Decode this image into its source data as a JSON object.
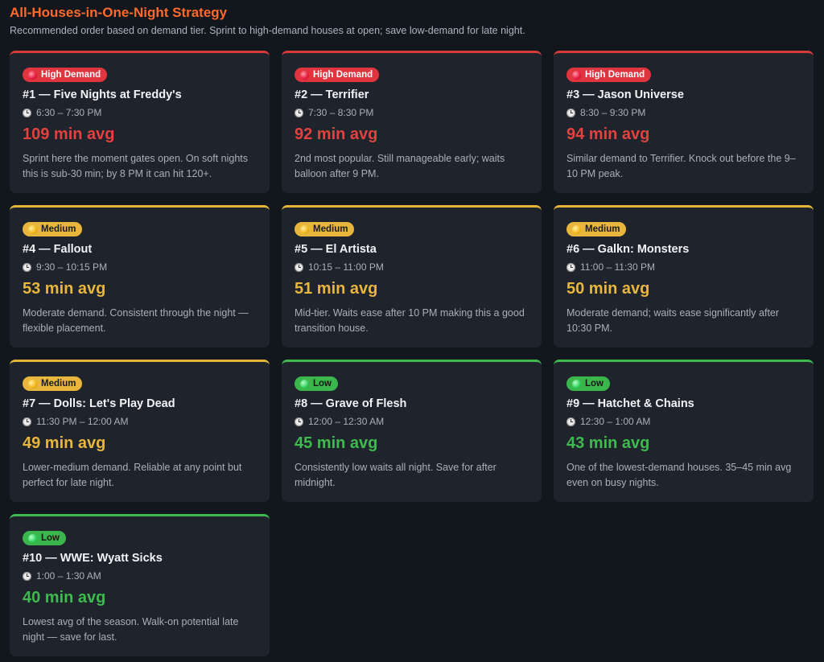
{
  "header": {
    "title": "All-Houses-in-One-Night Strategy",
    "subtitle": "Recommended order based on demand tier. Sprint to high-demand houses at open; save low-demand for late night."
  },
  "colors": {
    "high": "#d63b3b",
    "medium": "#e6b33a",
    "low": "#3fba4f",
    "title": "#ff6a2b"
  },
  "cards": [
    {
      "tier": "high",
      "badge": "High Demand",
      "name": "#1 — Five Nights at Freddy's",
      "time": "6:30 – 7:30 PM",
      "avg": "109 min avg",
      "desc": "Sprint here the moment gates open. On soft nights this is sub-30 min; by 8 PM it can hit 120+."
    },
    {
      "tier": "high",
      "badge": "High Demand",
      "name": "#2 — Terrifier",
      "time": "7:30 – 8:30 PM",
      "avg": "92 min avg",
      "desc": "2nd most popular. Still manageable early; waits balloon after 9 PM."
    },
    {
      "tier": "high",
      "badge": "High Demand",
      "name": "#3 — Jason Universe",
      "time": "8:30 – 9:30 PM",
      "avg": "94 min avg",
      "desc": "Similar demand to Terrifier. Knock out before the 9–10 PM peak."
    },
    {
      "tier": "medium",
      "badge": "Medium",
      "name": "#4 — Fallout",
      "time": "9:30 – 10:15 PM",
      "avg": "53 min avg",
      "desc": "Moderate demand. Consistent through the night — flexible placement."
    },
    {
      "tier": "medium",
      "badge": "Medium",
      "name": "#5 — El Artista",
      "time": "10:15 – 11:00 PM",
      "avg": "51 min avg",
      "desc": "Mid-tier. Waits ease after 10 PM making this a good transition house."
    },
    {
      "tier": "medium",
      "badge": "Medium",
      "name": "#6 — Galkn: Monsters",
      "time": "11:00 – 11:30 PM",
      "avg": "50 min avg",
      "desc": "Moderate demand; waits ease significantly after 10:30 PM."
    },
    {
      "tier": "medium",
      "badge": "Medium",
      "name": "#7 — Dolls: Let's Play Dead",
      "time": "11:30 PM – 12:00 AM",
      "avg": "49 min avg",
      "desc": "Lower-medium demand. Reliable at any point but perfect for late night."
    },
    {
      "tier": "low",
      "badge": "Low",
      "name": "#8 — Grave of Flesh",
      "time": "12:00 – 12:30 AM",
      "avg": "45 min avg",
      "desc": "Consistently low waits all night. Save for after midnight."
    },
    {
      "tier": "low",
      "badge": "Low",
      "name": "#9 — Hatchet & Chains",
      "time": "12:30 – 1:00 AM",
      "avg": "43 min avg",
      "desc": "One of the lowest-demand houses. 35–45 min avg even on busy nights."
    },
    {
      "tier": "low",
      "badge": "Low",
      "name": "#10 — WWE: Wyatt Sicks",
      "time": "1:00 – 1:30 AM",
      "avg": "40 min avg",
      "desc": "Lowest avg of the season. Walk-on potential late night — save for last."
    }
  ]
}
